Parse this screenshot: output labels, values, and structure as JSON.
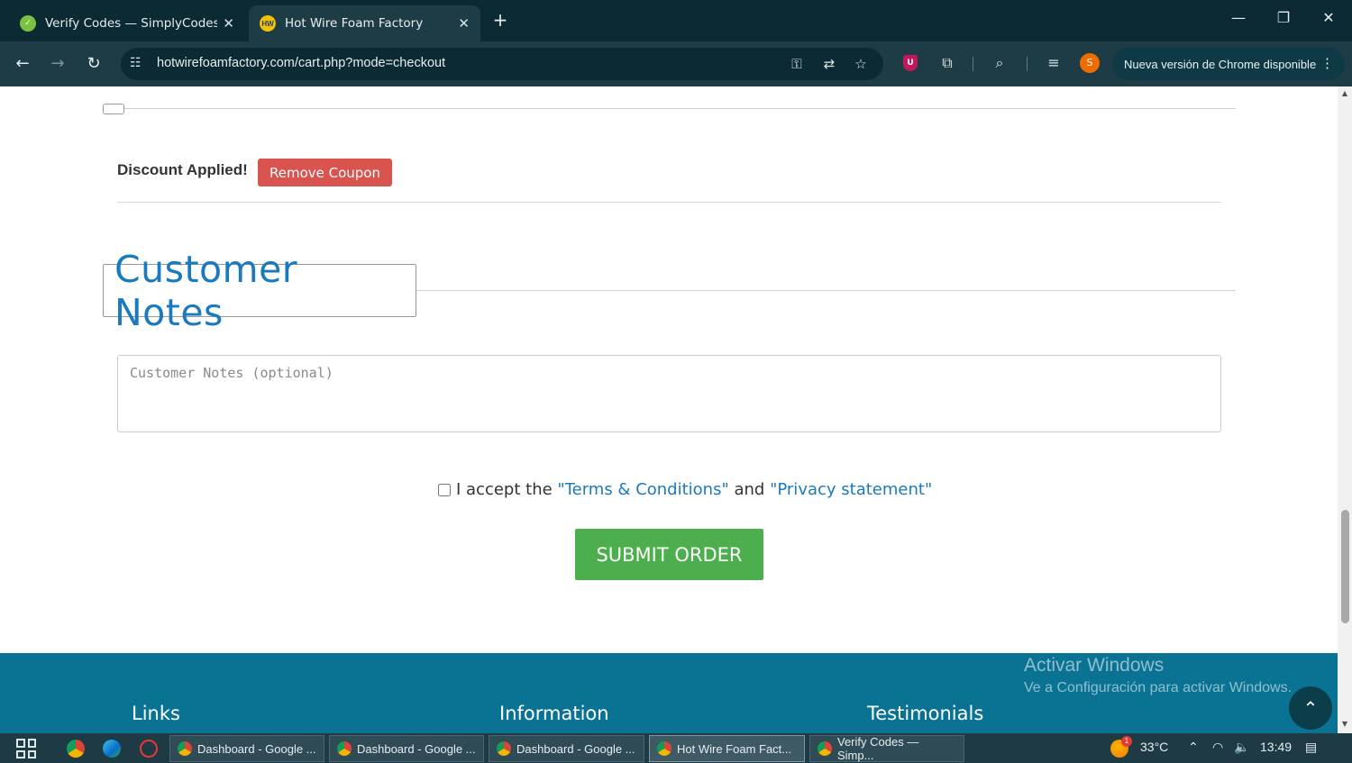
{
  "browser": {
    "tabs": [
      {
        "title": "Verify Codes — SimplyCodes",
        "active": false
      },
      {
        "title": "Hot Wire Foam Factory",
        "active": true
      }
    ],
    "url": "hotwirefoamfactory.com/cart.php?mode=checkout",
    "update_pill": "Nueva versión de Chrome disponible",
    "avatar_letter": "S",
    "shield_letter": "U"
  },
  "checkout": {
    "discount_label": "Discount Applied!",
    "remove_coupon": "Remove Coupon",
    "notes_title": "Customer Notes",
    "notes_placeholder": "Customer Notes (optional)",
    "accept_prefix": "I accept the",
    "terms_link": "\"Terms & Conditions\"",
    "and_text": "and",
    "privacy_link": "\"Privacy statement\"",
    "submit": "SUBMIT ORDER"
  },
  "footer": {
    "headings": [
      "Links",
      "Information",
      "Testimonials"
    ]
  },
  "watermark": {
    "line1": "Activar Windows",
    "line2": "Ve a Configuración para activar Windows."
  },
  "taskbar": {
    "apps": [
      {
        "label": "Dashboard - Google ...",
        "active": false
      },
      {
        "label": "Dashboard - Google ...",
        "active": false
      },
      {
        "label": "Dashboard - Google ...",
        "active": false
      },
      {
        "label": "Hot Wire Foam Fact...",
        "active": true
      },
      {
        "label": "Verify Codes — Simp...",
        "active": false
      }
    ],
    "weather_badge": "1",
    "temperature": "33°C",
    "time": "13:49"
  }
}
